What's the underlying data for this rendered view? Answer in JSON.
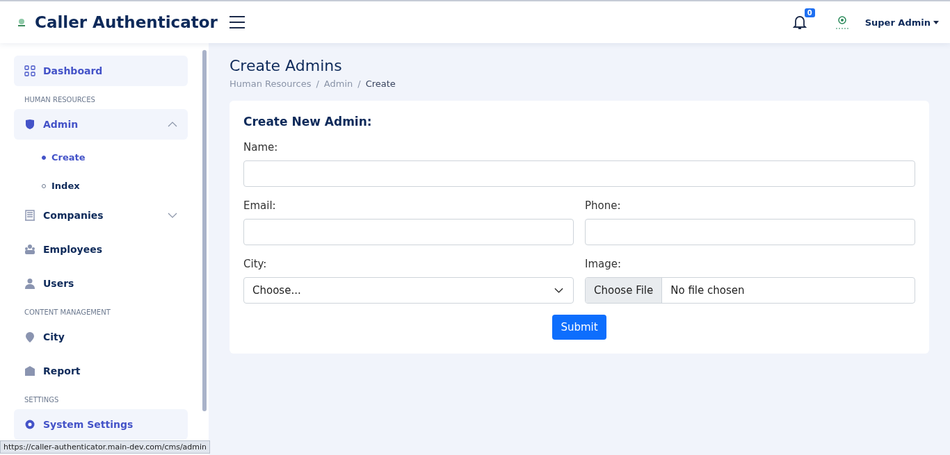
{
  "app": {
    "title": "Caller Authenticator",
    "notifications": "0",
    "user": "Super Admin"
  },
  "sidebar": {
    "items": [
      {
        "kind": "link",
        "label": "Dashboard",
        "active": true
      },
      {
        "kind": "header",
        "label": "HUMAN RESOURCES"
      },
      {
        "kind": "group",
        "label": "Admin",
        "active": true,
        "expanded": true,
        "children": [
          {
            "label": "Create",
            "selected": true
          },
          {
            "label": "Index",
            "selected": false
          }
        ]
      },
      {
        "kind": "group",
        "label": "Companies",
        "active": false,
        "expanded": false
      },
      {
        "kind": "link",
        "label": "Employees",
        "active": false
      },
      {
        "kind": "link",
        "label": "Users",
        "active": false
      },
      {
        "kind": "header",
        "label": "CONTENT MANAGEMENT"
      },
      {
        "kind": "link",
        "label": "City",
        "active": false
      },
      {
        "kind": "link",
        "label": "Report",
        "active": false
      },
      {
        "kind": "header",
        "label": "SETTINGS"
      },
      {
        "kind": "link",
        "label": "System Settings",
        "active": true
      }
    ]
  },
  "page": {
    "title": "Create Admins",
    "breadcrumb": [
      "Human Resources",
      "Admin",
      "Create"
    ],
    "breadcrumb_separator": "/"
  },
  "form": {
    "title": "Create New Admin:",
    "name_label": "Name:",
    "email_label": "Email:",
    "phone_label": "Phone:",
    "city_label": "City:",
    "city_value": "Choose...",
    "image_label": "Image:",
    "file_button": "Choose File",
    "file_status": "No file chosen",
    "submit": "Submit"
  },
  "status_url": "https://caller-authenticator.main-dev.com/cms/admin"
}
